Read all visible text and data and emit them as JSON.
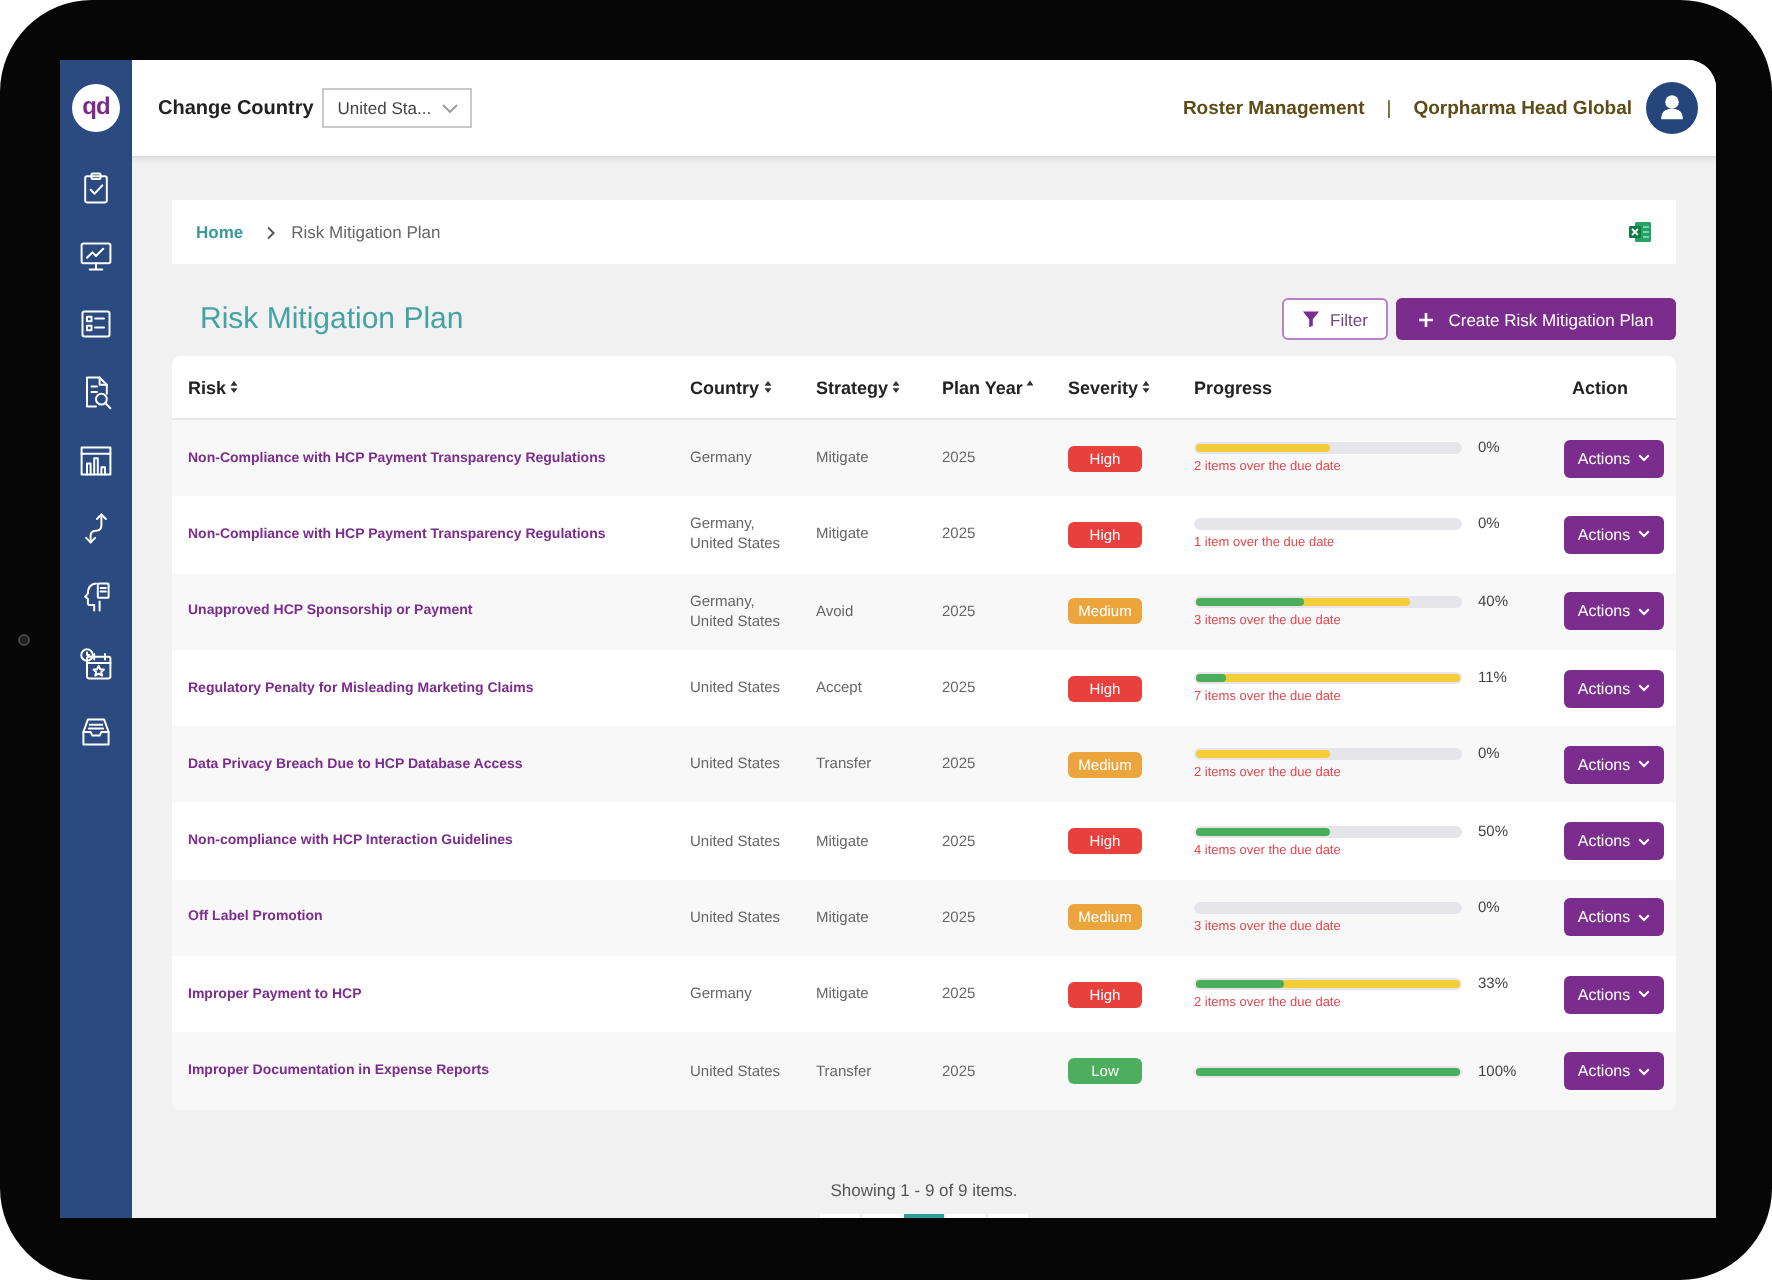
{
  "sidebar": {
    "logo": "qd",
    "items": [
      {
        "kind": "clipboard"
      },
      {
        "kind": "monitor"
      },
      {
        "kind": "list"
      },
      {
        "kind": "document"
      },
      {
        "kind": "building"
      },
      {
        "kind": "arrows"
      },
      {
        "kind": "head"
      },
      {
        "kind": "calendar"
      },
      {
        "kind": "inbox"
      }
    ]
  },
  "top_bar": {
    "country_label": "Change Country",
    "country_select": {
      "value": "United Sta..."
    },
    "module_link": "Roster Management",
    "separator": "|",
    "organization": "Qorpharma Head Global"
  },
  "breadcrumb": {
    "items": [
      {
        "label": "Home",
        "kind": "link"
      },
      {
        "label": "Risk Mitigation Plan",
        "kind": "current"
      }
    ]
  },
  "page": {
    "title": "Risk Mitigation Plan",
    "filter_button": "Filter",
    "create_button": "Create Risk Mitigation Plan"
  },
  "table": {
    "columns": [
      {
        "label": "Risk",
        "sortable": true,
        "sorted": false
      },
      {
        "label": "Country",
        "sortable": true,
        "sorted": false
      },
      {
        "label": "Strategy",
        "sortable": true,
        "sorted": false
      },
      {
        "label": "Plan Year",
        "sortable": true,
        "sorted": true
      },
      {
        "label": "Severity",
        "sortable": true,
        "sorted": false
      },
      {
        "label": "Progress",
        "sortable": false,
        "sorted": false
      },
      {
        "label": "Action",
        "sortable": false,
        "sorted": false
      }
    ],
    "rows": [
      {
        "risk": "Non-Compliance with HCP Payment Transparency Regulations",
        "country": "Germany",
        "strategy": "Mitigate",
        "plan_year": "2025",
        "severity": {
          "label": "High",
          "color": "#e8403d"
        },
        "progress": {
          "segments": [
            {
              "color": "#f4cd3b",
              "level": 0.5
            }
          ],
          "percent": "0%",
          "overdue": "2 items over the due date"
        },
        "action": "Actions"
      },
      {
        "risk": "Non-Compliance with HCP Payment Transparency Regulations",
        "country": "Germany, United States",
        "strategy": "Mitigate",
        "plan_year": "2025",
        "severity": {
          "label": "High",
          "color": "#e8403d"
        },
        "progress": {
          "percent": "0%",
          "overdue": "1 item over the due date"
        },
        "action": "Actions"
      },
      {
        "risk": "Unapproved HCP Sponsorship or Payment",
        "country": "Germany, United States",
        "strategy": "Avoid",
        "plan_year": "2025",
        "severity": {
          "label": "Medium",
          "color": "#eca53c"
        },
        "progress": {
          "segments": [
            {
              "color": "#4cae5c",
              "level": 0.4
            },
            {
              "color": "#f4cd3b",
              "level": 0.8
            }
          ],
          "percent": "40%",
          "overdue": "3 items over the due date"
        },
        "action": "Actions"
      },
      {
        "risk": "Regulatory Penalty for Misleading Marketing Claims",
        "country": "United States",
        "strategy": "Accept",
        "plan_year": "2025",
        "severity": {
          "label": "High",
          "color": "#e8403d"
        },
        "progress": {
          "segments": [
            {
              "color": "#4cae5c",
              "level": 0.11
            },
            {
              "color": "#f4cd3b",
              "level": 1
            }
          ],
          "percent": "11%",
          "overdue": "7 items over the due date"
        },
        "action": "Actions"
      },
      {
        "risk": "Data Privacy Breach Due to HCP Database Access",
        "country": "United States",
        "strategy": "Transfer",
        "plan_year": "2025",
        "severity": {
          "label": "Medium",
          "color": "#eca53c"
        },
        "progress": {
          "segments": [
            {
              "color": "#f4cd3b",
              "level": 0.5
            }
          ],
          "percent": "0%",
          "overdue": "2 items over the due date"
        },
        "action": "Actions"
      },
      {
        "risk": "Non-compliance with HCP Interaction Guidelines",
        "country": "United States",
        "strategy": "Mitigate",
        "plan_year": "2025",
        "severity": {
          "label": "High",
          "color": "#e8403d"
        },
        "progress": {
          "segments": [
            {
              "color": "#4cae5c",
              "level": 0.5
            }
          ],
          "percent": "50%",
          "overdue": "4 items over the due date"
        },
        "action": "Actions"
      },
      {
        "risk": "Off Label Promotion",
        "country": "United States",
        "strategy": "Mitigate",
        "plan_year": "2025",
        "severity": {
          "label": "Medium",
          "color": "#eca53c"
        },
        "progress": {
          "percent": "0%",
          "overdue": "3 items over the due date"
        },
        "action": "Actions"
      },
      {
        "risk": "Improper Payment to HCP",
        "country": "Germany",
        "strategy": "Mitigate",
        "plan_year": "2025",
        "severity": {
          "label": "High",
          "color": "#e8403d"
        },
        "progress": {
          "segments": [
            {
              "color": "#4cae5c",
              "level": 0.33
            },
            {
              "color": "#f4cd3b",
              "level": 1
            }
          ],
          "percent": "33%",
          "overdue": "2 items over the due date"
        },
        "action": "Actions"
      },
      {
        "risk": "Improper Documentation in Expense Reports",
        "country": "United States",
        "strategy": "Transfer",
        "plan_year": "2025",
        "severity": {
          "label": "Low",
          "color": "#4cae5e"
        },
        "progress": {
          "segments": [
            {
              "color": "#4cae5c",
              "level": 1
            }
          ],
          "percent": "100%"
        },
        "action": "Actions"
      }
    ]
  },
  "footer": {
    "summary": "Showing 1 - 9 of 9 items.",
    "pages": [
      {
        "selected": false
      },
      {
        "selected": false
      },
      {
        "selected": true
      },
      {
        "selected": false
      },
      {
        "selected": false
      }
    ]
  }
}
